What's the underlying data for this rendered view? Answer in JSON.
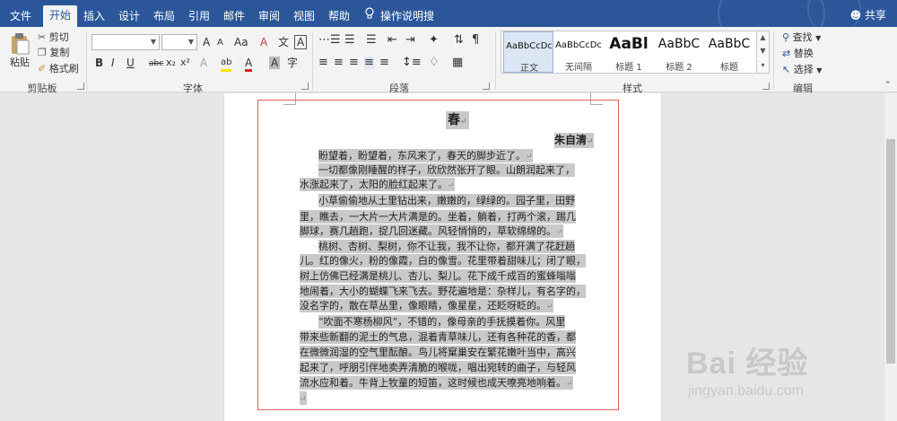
{
  "tabs": [
    {
      "label": "文件"
    },
    {
      "label": "开始"
    },
    {
      "label": "插入"
    },
    {
      "label": "设计"
    },
    {
      "label": "布局"
    },
    {
      "label": "引用"
    },
    {
      "label": "邮件"
    },
    {
      "label": "审阅"
    },
    {
      "label": "视图"
    },
    {
      "label": "帮助"
    }
  ],
  "tell_me": "操作说明搜索",
  "share": "共享",
  "clipboard": {
    "paste": "粘贴",
    "cut": "剪切",
    "copy": "复制",
    "format_painter": "格式刷",
    "group": "剪贴板"
  },
  "font": {
    "group": "字体",
    "grow": "A",
    "shrink": "A",
    "case": "Aa",
    "clear": "A",
    "phonetic": "文",
    "border_char": "A",
    "bold": "B",
    "italic": "I",
    "underline": "U",
    "strike": "abc",
    "sub": "x₂",
    "sup": "x²",
    "effects": "A",
    "highlight": "ab",
    "color": "A",
    "shade": "A",
    "circle": "字"
  },
  "paragraph": {
    "group": "段落"
  },
  "styles": {
    "group": "样式",
    "items": [
      {
        "preview": "AaBbCcDc",
        "name": "正文",
        "selected": true
      },
      {
        "preview": "AaBbCcDc",
        "name": "无间隔",
        "selected": false
      },
      {
        "preview": "AaBl",
        "name": "标题 1",
        "selected": false
      },
      {
        "preview": "AaBbC",
        "name": "标题 2",
        "selected": false
      },
      {
        "preview": "AaBbC",
        "name": "标题",
        "selected": false
      }
    ]
  },
  "editing": {
    "find": "查找",
    "replace": "替换",
    "select": "选择",
    "group": "编辑"
  },
  "document": {
    "title": "春",
    "author": "朱自清",
    "lines": [
      "盼望着，盼望着，东风来了，春天的脚步近了。",
      "一切都像刚睡醒的样子，欣欣然张开了眼。山朗润起来了，",
      "水涨起来了，太阳的脸红起来了。",
      "小草偷偷地从土里钻出来，嫩嫩的，绿绿的。园子里，田野",
      "里，瞧去，一大片一大片满是的。坐着，躺着，打两个滚，踢几",
      "脚球，赛几趟跑，捉几回迷藏。风轻悄悄的，草软绵绵的。",
      "桃树、杏树、梨树，你不让我，我不让你，都开满了花赶趟",
      "儿。红的像火，粉的像霞，白的像雪。花里带着甜味儿；闭了眼，",
      "树上仿佛已经满是桃儿、杏儿、梨儿。花下成千成百的蜜蜂嗡嗡",
      "地闹着，大小的蝴蝶飞来飞去。野花遍地是：杂样儿，有名字的，",
      "没名字的，散在草丛里，像眼睛，像星星，还眨呀眨的。",
      "“吹面不寒杨柳风”，不错的，像母亲的手抚摸着你。风里",
      "带来些新翻的泥土的气息，混着青草味儿，还有各种花的香，都",
      "在微微润湿的空气里酝酿。鸟儿将窠巢安在繁花嫩叶当中，高兴",
      "起来了，呼朋引伴地卖弄清脆的喉咙，唱出宛转的曲子，与轻风",
      "流水应和着。牛背上牧童的短笛，这时候也成天嘹亮地响着。"
    ]
  },
  "watermark": {
    "brand": "Bai  经验",
    "url": "jingyan.baidu.com"
  },
  "colors": {
    "accent": "#2b579a",
    "selection": "#c9c9c9",
    "frame": "#e45b5b"
  }
}
